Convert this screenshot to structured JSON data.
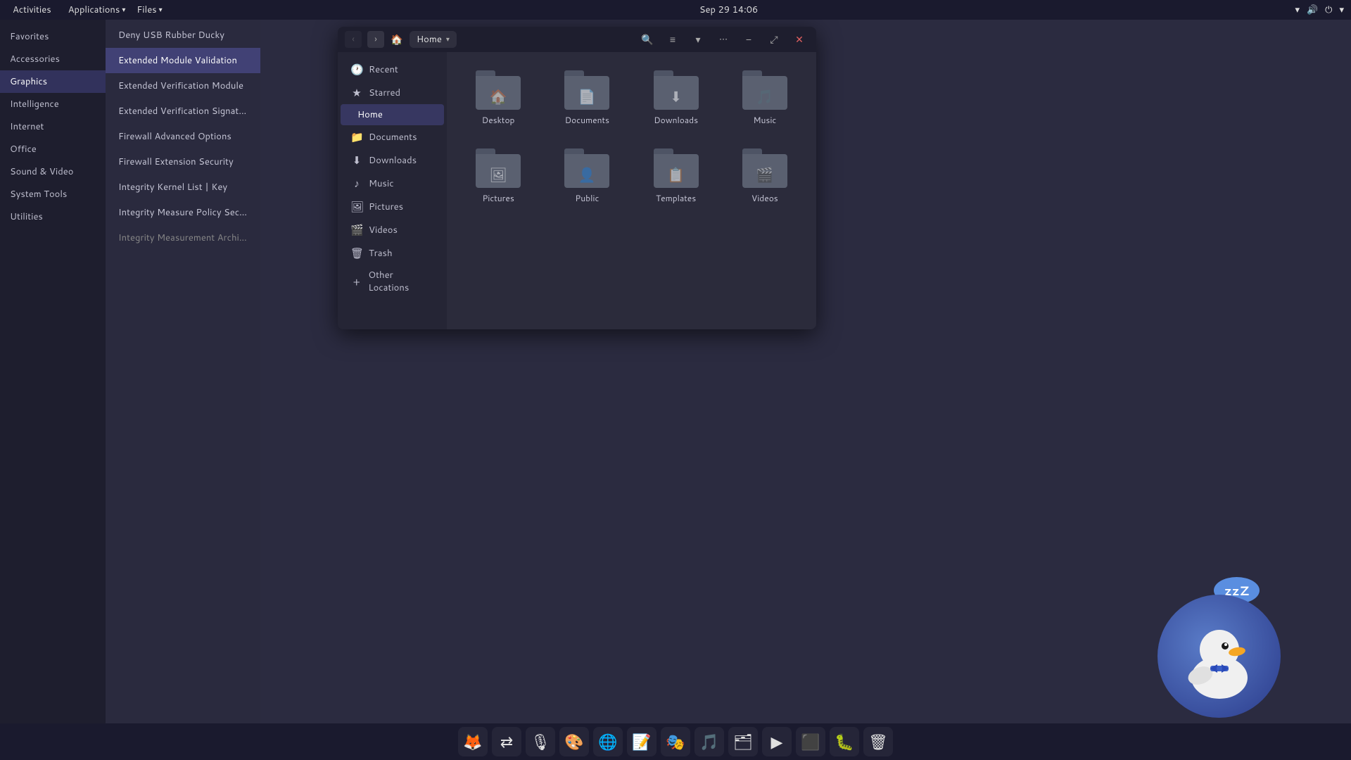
{
  "topbar": {
    "activities": "Activities",
    "applications": "Applications",
    "files": "Files",
    "datetime": "Sep 29  14:06",
    "apps_arrow": "▾",
    "files_arrow": "▾"
  },
  "categories": [
    {
      "id": "favorites",
      "label": "Favorites"
    },
    {
      "id": "accessories",
      "label": "Accessories"
    },
    {
      "id": "graphics",
      "label": "Graphics",
      "active": true
    },
    {
      "id": "intelligence",
      "label": "Intelligence"
    },
    {
      "id": "internet",
      "label": "Internet"
    },
    {
      "id": "office",
      "label": "Office"
    },
    {
      "id": "sound_video",
      "label": "Sound & Video"
    },
    {
      "id": "system_tools",
      "label": "System Tools"
    },
    {
      "id": "utilities",
      "label": "Utilities"
    }
  ],
  "apps": [
    {
      "label": "Deny USB Rubber Ducky"
    },
    {
      "label": "Extended Module Validation",
      "selected": true
    },
    {
      "label": "Extended Verification Module"
    },
    {
      "label": "Extended Verification Signature"
    },
    {
      "label": "Firewall Advanced Options"
    },
    {
      "label": "Firewall Extension Security"
    },
    {
      "label": "Integrity Kernel List | Key"
    },
    {
      "label": "Integrity Measure Policy Security"
    },
    {
      "label": "Integrity Measurement Architecture",
      "dimmed": true
    }
  ],
  "file_manager": {
    "title": "Home",
    "location": "Home",
    "sidebar": {
      "recent": "Recent",
      "starred": "Starred",
      "home": "Home",
      "documents": "Documents",
      "downloads": "Downloads",
      "music": "Music",
      "pictures": "Pictures",
      "videos": "Videos",
      "trash": "Trash",
      "other_locations": "Other Locations"
    },
    "folders": [
      {
        "name": "Desktop",
        "icon": "🏠"
      },
      {
        "name": "Documents",
        "icon": "📄"
      },
      {
        "name": "Downloads",
        "icon": "⬇"
      },
      {
        "name": "Music",
        "icon": "🎵"
      },
      {
        "name": "Pictures",
        "icon": "🖼"
      },
      {
        "name": "Public",
        "icon": "👤"
      },
      {
        "name": "Templates",
        "icon": "📋"
      },
      {
        "name": "Videos",
        "icon": "🎬"
      }
    ]
  },
  "duck": {
    "zzz": "zzZ"
  },
  "taskbar": {
    "icons": [
      {
        "name": "firefox",
        "symbol": "🦊"
      },
      {
        "name": "switch",
        "symbol": "⇄"
      },
      {
        "name": "podcast",
        "symbol": "🎙"
      },
      {
        "name": "paint",
        "symbol": "🎨"
      },
      {
        "name": "browser2",
        "symbol": "🌐"
      },
      {
        "name": "notes",
        "symbol": "📝"
      },
      {
        "name": "mask",
        "symbol": "🎭"
      },
      {
        "name": "music2",
        "symbol": "🎵"
      },
      {
        "name": "files",
        "symbol": "🗂"
      },
      {
        "name": "store",
        "symbol": "▶"
      },
      {
        "name": "terminal",
        "symbol": "⬛"
      },
      {
        "name": "bug",
        "symbol": "🐛"
      },
      {
        "name": "trash2",
        "symbol": "🗑"
      }
    ]
  }
}
